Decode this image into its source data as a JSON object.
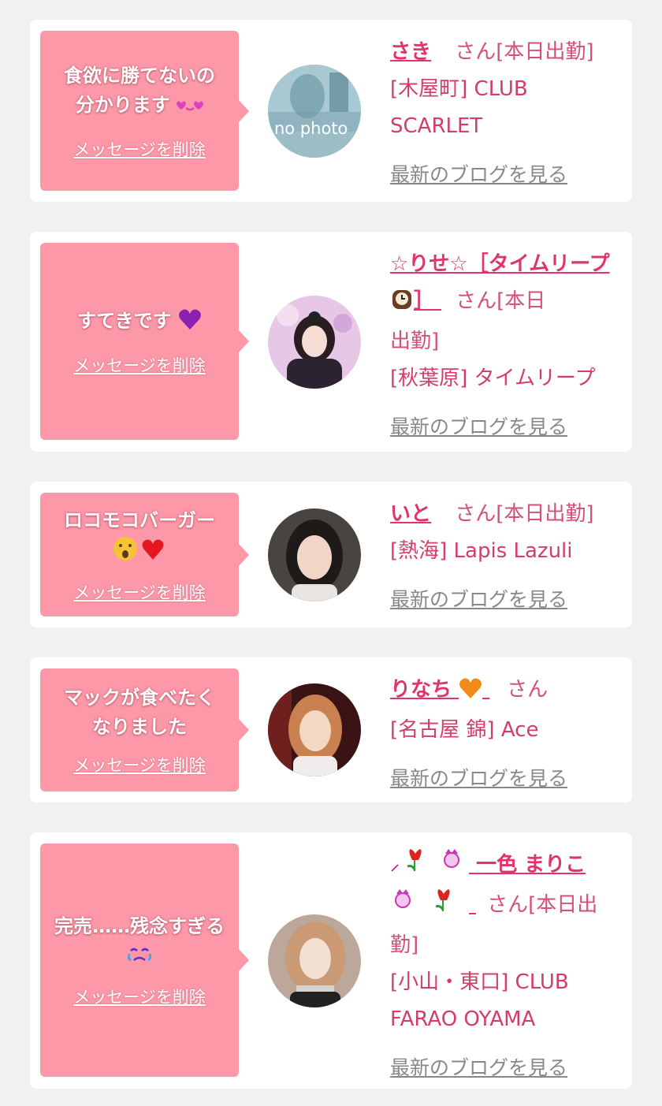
{
  "delete_label": "メッセージを削除",
  "blog_label": "最新のブログを見る",
  "colors": {
    "bubble": "#fd98a8",
    "name": "#e0346a",
    "text": "#d43c6a",
    "link_gray": "#888888",
    "background": "#f1f1f1"
  },
  "items": [
    {
      "message_line1": "食欲に勝てないの",
      "message_line2": "分かります",
      "message_icon": "kissing-heart-face-icon",
      "name": "さき",
      "suffix": "さん[本日出勤]",
      "shop_line1": "[木屋町] CLUB",
      "shop_line2": "SCARLET",
      "avatar_text": "no photo"
    },
    {
      "message_line1": "すてきです",
      "message_icon": "purple-heart-icon",
      "name_part1": "☆りせ☆［タイムリ",
      "name_part2": "ープ",
      "name_part3": "］",
      "name_icon": "mantelpiece-clock-icon",
      "suffix": "さん[本日",
      "suffix2": "出勤]",
      "shop_line1": "[秋葉原] タイムリープ"
    },
    {
      "message_line1": "ロコモコバーガー",
      "message_icon": "drooling-face-and-red-heart-icon",
      "name": "いと",
      "suffix": "さん[本日出勤]",
      "shop_line1": "[熱海] Lapis Lazuli"
    },
    {
      "message_line1": "マックが食べたく",
      "message_line2": "なりました",
      "name": "りなち",
      "name_icon": "orange-heart-icon",
      "suffix": "さん",
      "shop_line1": "[名古屋 錦] Ace"
    },
    {
      "message_line1": "完売……残念すぎる",
      "message_icon": "crying-face-icon",
      "name_part1": "一色 まりこ",
      "name_icon": "tulip-and-princess-icon",
      "suffix": "さん[本日出",
      "suffix2": "勤]",
      "shop_line1": "[小山・東口] CLUB",
      "shop_line2": "FARAO OYAMA"
    }
  ]
}
